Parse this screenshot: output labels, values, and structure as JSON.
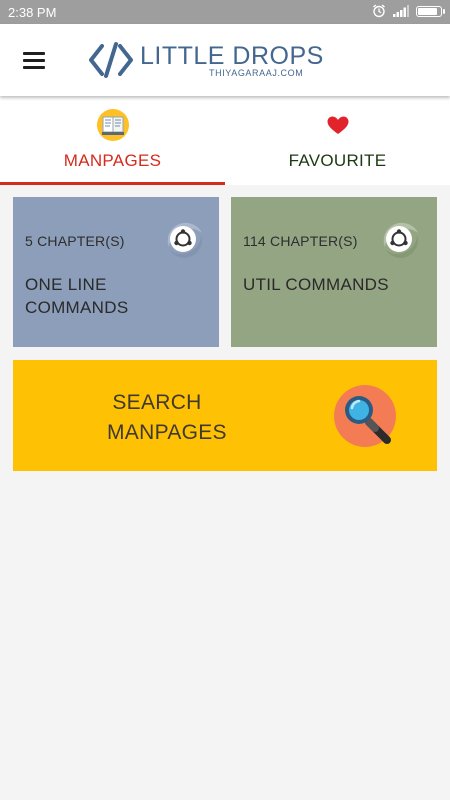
{
  "status_bar": {
    "time": "2:38 PM",
    "icons": [
      "alarm-icon",
      "signal-icon",
      "battery-icon"
    ],
    "battery_level": 0.9
  },
  "app_bar": {
    "menu_icon": "hamburger-menu-icon",
    "logo_title": "LITTLE DROPS",
    "logo_subtitle": "THIYAGARAAJ.COM"
  },
  "tabs": [
    {
      "label": "MANPAGES",
      "icon": "notebook-icon",
      "selected": true
    },
    {
      "label": "FAVOURITE",
      "icon": "heart-icon",
      "selected": false
    }
  ],
  "cards": [
    {
      "count": "5 CHAPTER(S)",
      "title_line1": "ONE LINE",
      "title_line2": "COMMANDS",
      "icon": "ubuntu-icon",
      "color": "#8c9eb9"
    },
    {
      "count": "114 CHAPTER(S)",
      "title_line1": "UTIL COMMANDS",
      "title_line2": "",
      "icon": "ubuntu-icon",
      "color": "#94a583"
    }
  ],
  "search": {
    "line1": "SEARCH",
    "line2": "MANPAGES",
    "icon": "magnifier-icon",
    "color": "#fec104"
  },
  "colors": {
    "accent": "#d62a1e",
    "brand": "#43678f"
  }
}
